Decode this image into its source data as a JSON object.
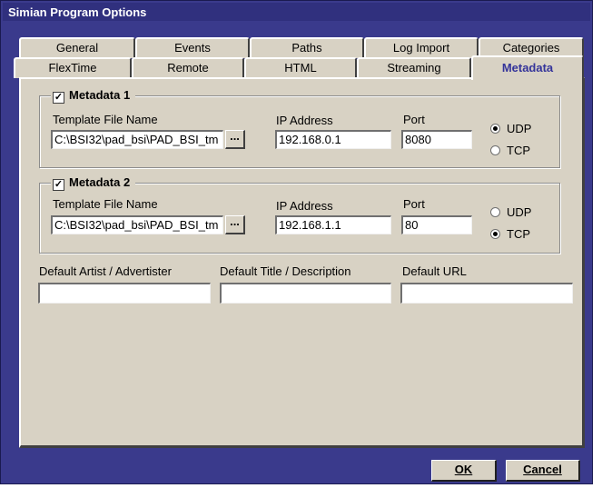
{
  "window": {
    "title": "Simian Program Options"
  },
  "tabs": {
    "row_back": [
      "General",
      "Events",
      "Paths",
      "Log Import",
      "Categories"
    ],
    "row_front": [
      "FlexTime",
      "Remote",
      "HTML",
      "Streaming",
      "Metadata"
    ],
    "active": "Metadata"
  },
  "metadata1": {
    "label": "Metadata 1",
    "checked": true,
    "template_label": "Template File Name",
    "template_value": "C:\\BSI32\\pad_bsi\\PAD_BSI_tm",
    "browse": "...",
    "ip_label": "IP Address",
    "ip_value": "192.168.0.1",
    "port_label": "Port",
    "port_value": "8080",
    "udp": "UDP",
    "tcp": "TCP",
    "protocol": "UDP"
  },
  "metadata2": {
    "label": "Metadata 2",
    "checked": true,
    "template_label": "Template File Name",
    "template_value": "C:\\BSI32\\pad_bsi\\PAD_BSI_tm",
    "browse": "...",
    "ip_label": "IP Address",
    "ip_value": "192.168.1.1",
    "port_label": "Port",
    "port_value": "80",
    "udp": "UDP",
    "tcp": "TCP",
    "protocol": "TCP"
  },
  "defaults": {
    "artist_label": "Default Artist / Advertister",
    "artist_value": "",
    "title_label": "Default Title / Description",
    "title_value": "",
    "url_label": "Default URL",
    "url_value": ""
  },
  "buttons": {
    "ok": "OK",
    "cancel": "Cancel"
  },
  "check_glyph": "✓",
  "colors": {
    "titlebar": "#30307e",
    "frame": "#3a3a8c",
    "face": "#d8d2c4",
    "active_tab_text": "#34349a"
  }
}
